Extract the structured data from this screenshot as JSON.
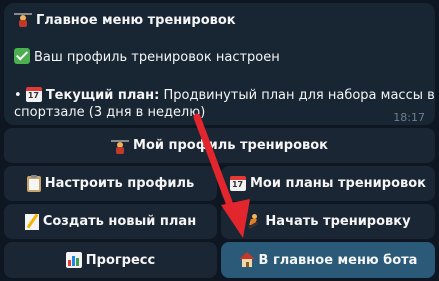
{
  "message": {
    "title": "Главное меню тренировок",
    "status_line": "Ваш профиль тренировок настроен",
    "plan_bullet": "•",
    "plan_label": "Текущий план:",
    "plan_text_line1": "Продвинутый план для набора массы в",
    "plan_text_line2": "спортзале (3 дня в неделю)",
    "time": "18:17",
    "icons": {
      "title": "weightlifter-icon",
      "status": "check-mark-icon",
      "plan": "calendar-icon"
    }
  },
  "keyboard": {
    "buttons": [
      {
        "label": "Мой профиль тренировок",
        "icon": "weightlifter-icon"
      },
      {
        "label": "Настроить профиль",
        "icon": "clipboard-icon"
      },
      {
        "label": "Мои планы тренировок",
        "icon": "calendar-icon"
      },
      {
        "label": "Создать новый план",
        "icon": "memo-icon"
      },
      {
        "label": "Начать тренировку",
        "icon": "runner-icon"
      },
      {
        "label": "Прогресс",
        "icon": "bar-chart-icon"
      },
      {
        "label": "В главное меню бота",
        "icon": "house-icon"
      }
    ]
  },
  "colors": {
    "background": "#0e1621",
    "bubble": "#182533",
    "button": "#1a2633",
    "button_active": "#2a5a77",
    "annotation_arrow": "#e3262e"
  }
}
